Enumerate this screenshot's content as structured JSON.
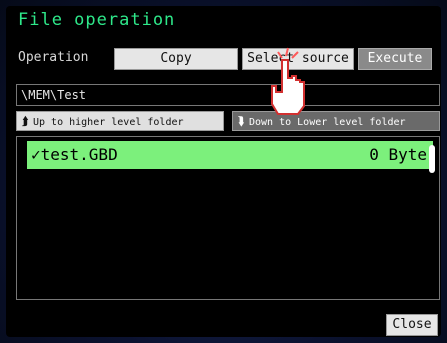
{
  "window": {
    "title": "File operation"
  },
  "operation": {
    "label": "Operation",
    "copy_label": "Copy",
    "select_source_label": "Select source",
    "execute_label": "Execute"
  },
  "path": {
    "value": "\\MEM\\Test"
  },
  "nav": {
    "up_label": "Up to higher level folder",
    "down_label": "Down to Lower level folder"
  },
  "files": [
    {
      "name": "✓test.GBD",
      "size": "0 Byte",
      "selected": true
    }
  ],
  "footer": {
    "close_label": "Close"
  },
  "colors": {
    "title": "#2ee88a",
    "selected_row": "#7cf07c",
    "background": "#000000"
  },
  "icons": {
    "up": "folder-up-icon",
    "down": "folder-down-icon",
    "pointer": "pointing-hand-icon"
  }
}
